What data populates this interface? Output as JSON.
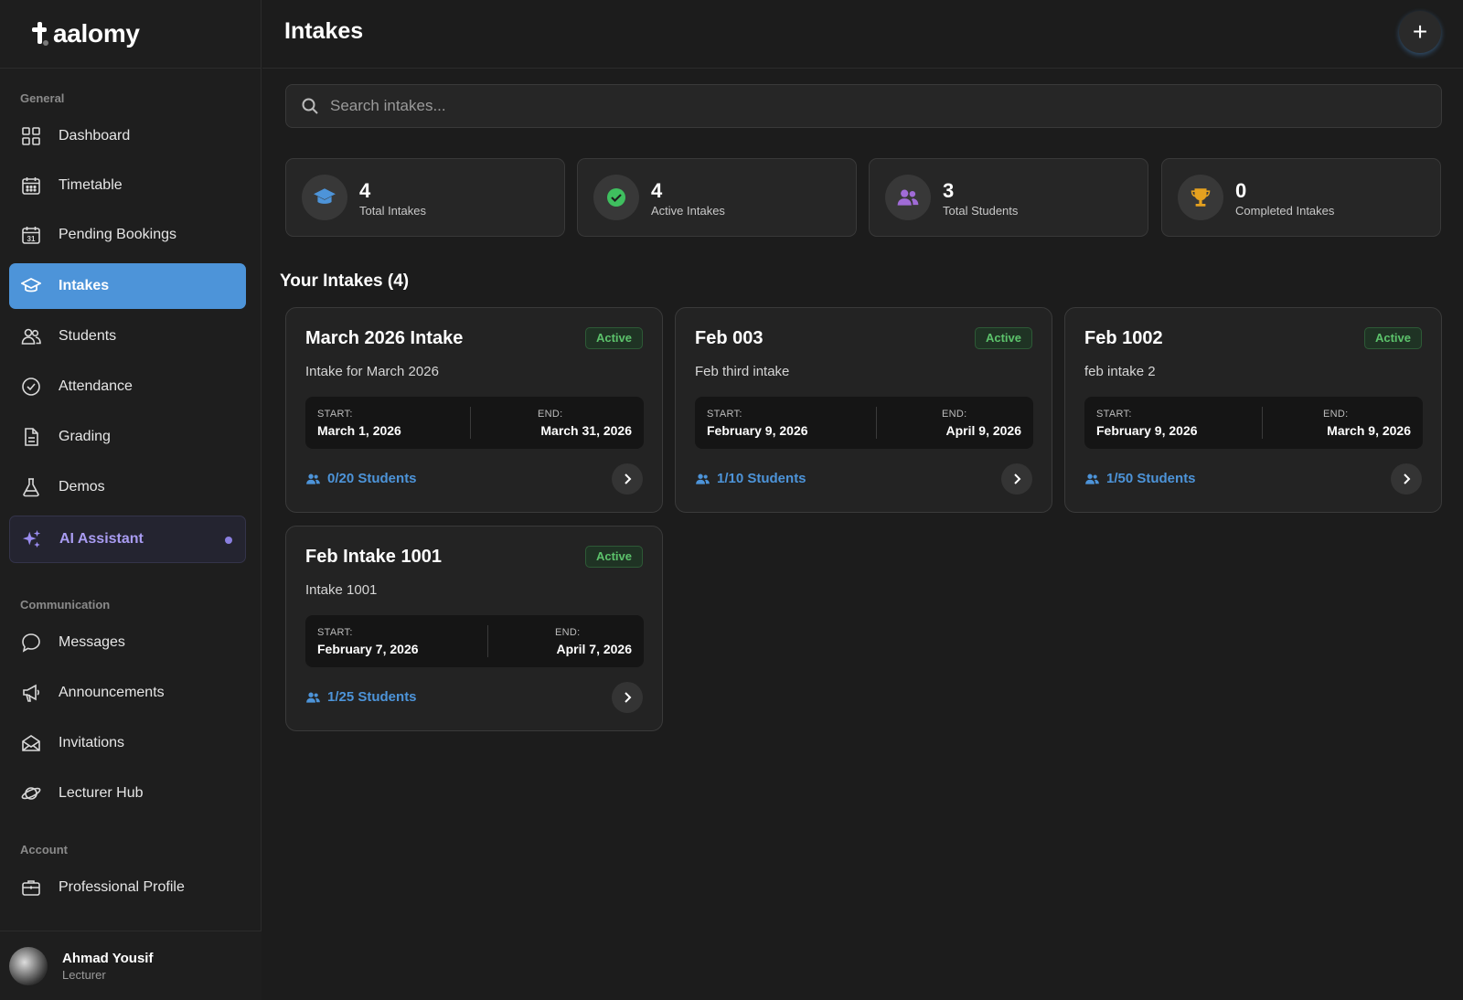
{
  "brand": {
    "logo_text": "aalomy"
  },
  "sidebar": {
    "sections": {
      "general": "General",
      "communication": "Communication",
      "account": "Account"
    },
    "items": [
      {
        "label": "Dashboard",
        "icon": "grid-icon"
      },
      {
        "label": "Timetable",
        "icon": "calendar-icon"
      },
      {
        "label": "Pending Bookings",
        "icon": "calendar-31-icon"
      },
      {
        "label": "Intakes",
        "icon": "graduation-cap-icon",
        "active": true
      },
      {
        "label": "Students",
        "icon": "users-icon"
      },
      {
        "label": "Attendance",
        "icon": "check-circle-icon"
      },
      {
        "label": "Grading",
        "icon": "document-icon"
      },
      {
        "label": "Demos",
        "icon": "flask-icon"
      },
      {
        "label": "AI Assistant",
        "icon": "sparkles-icon"
      },
      {
        "label": "Messages",
        "icon": "chat-bubble-icon"
      },
      {
        "label": "Announcements",
        "icon": "megaphone-icon"
      },
      {
        "label": "Invitations",
        "icon": "envelope-open-icon"
      },
      {
        "label": "Lecturer Hub",
        "icon": "planet-icon"
      },
      {
        "label": "Professional Profile",
        "icon": "briefcase-icon"
      }
    ],
    "user": {
      "name": "Ahmad Yousif",
      "role": "Lecturer"
    }
  },
  "header": {
    "title": "Intakes",
    "add_label": "+"
  },
  "search": {
    "placeholder": "Search intakes..."
  },
  "stats": [
    {
      "value": "4",
      "label": "Total Intakes",
      "icon": "graduation-cap-icon",
      "color": "#4d94d9"
    },
    {
      "value": "4",
      "label": "Active Intakes",
      "icon": "check-circle-icon",
      "color": "#3fbf5f"
    },
    {
      "value": "3",
      "label": "Total Students",
      "icon": "users-icon",
      "color": "#a06bd6"
    },
    {
      "value": "0",
      "label": "Completed Intakes",
      "icon": "trophy-icon",
      "color": "#e5a11f"
    }
  ],
  "intakes_section": {
    "title": "Your Intakes (4)"
  },
  "intakes": [
    {
      "title": "March 2026 Intake",
      "status": "Active",
      "description": "Intake for March 2026",
      "start_label": "START:",
      "start": "March 1, 2026",
      "end_label": "END:",
      "end": "March 31, 2026",
      "students": "0/20 Students"
    },
    {
      "title": "Feb 003",
      "status": "Active",
      "description": "Feb third intake",
      "start_label": "START:",
      "start": "February 9, 2026",
      "end_label": "END:",
      "end": "April 9, 2026",
      "students": "1/10 Students"
    },
    {
      "title": "Feb 1002",
      "status": "Active",
      "description": "feb intake 2",
      "start_label": "START:",
      "start": "February 9, 2026",
      "end_label": "END:",
      "end": "March 9, 2026",
      "students": "1/50 Students"
    },
    {
      "title": "Feb Intake 1001",
      "status": "Active",
      "description": "Intake 1001",
      "start_label": "START:",
      "start": "February 7, 2026",
      "end_label": "END:",
      "end": "April 7, 2026",
      "students": "1/25 Students"
    }
  ]
}
